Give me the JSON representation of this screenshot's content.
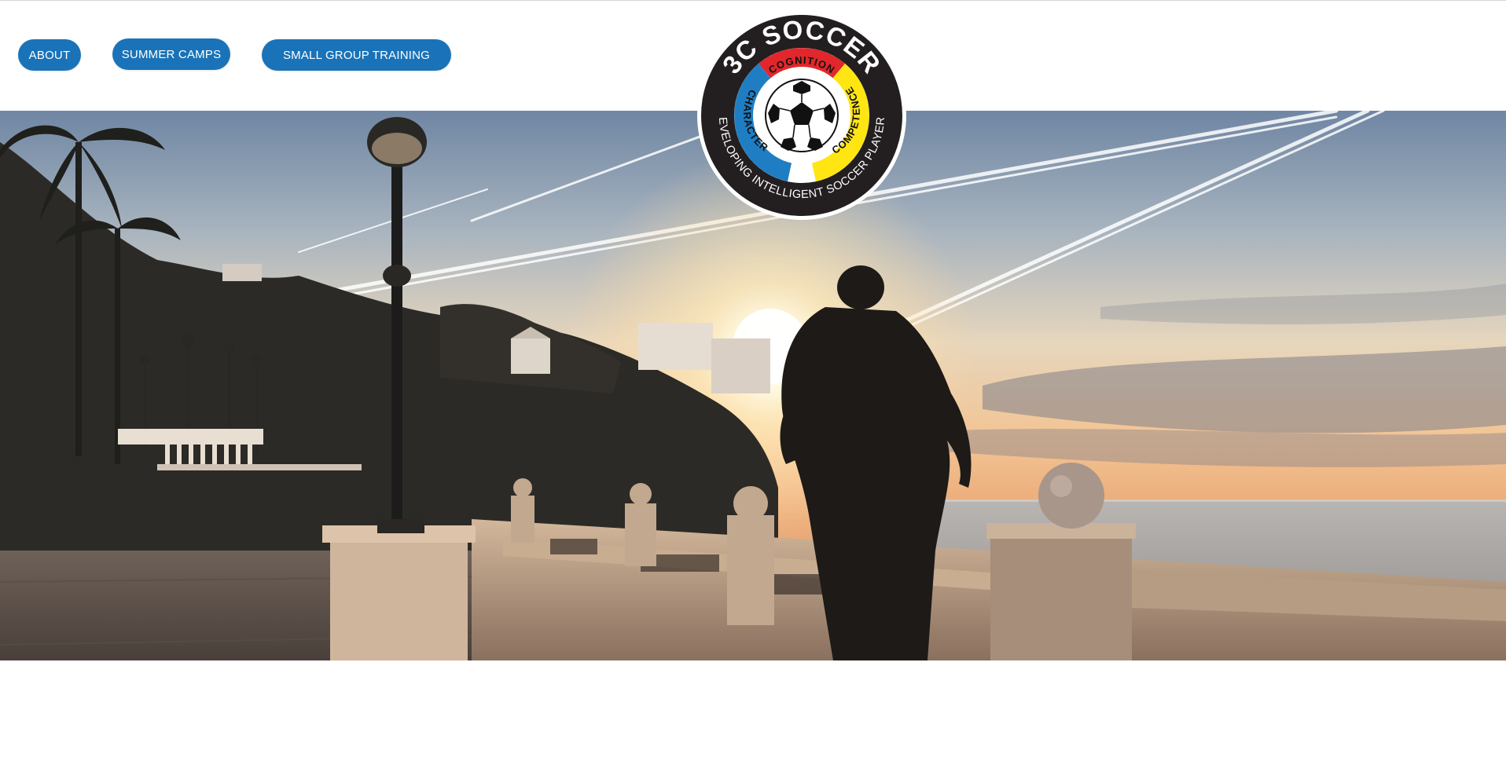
{
  "nav": {
    "items": [
      {
        "label": "ABOUT"
      },
      {
        "label": "SUMMER CAMPS"
      },
      {
        "label": "SMALL GROUP TRAINING"
      }
    ]
  },
  "logo": {
    "brand": "3C SOCCER",
    "pillars": [
      "COGNITION",
      "CHARACTER",
      "COMPETENCE"
    ],
    "tagline": "DEVELOPING INTELLIGENT SOCCER PLAYERS"
  },
  "colors": {
    "button": "#1a73b8",
    "logo_ring": "#231f20",
    "cognition": "#e2262b",
    "character": "#1f7ec3",
    "competence": "#ffe512"
  },
  "hero": {
    "image": "silhouette-running-seaside-promenade-sunset"
  }
}
